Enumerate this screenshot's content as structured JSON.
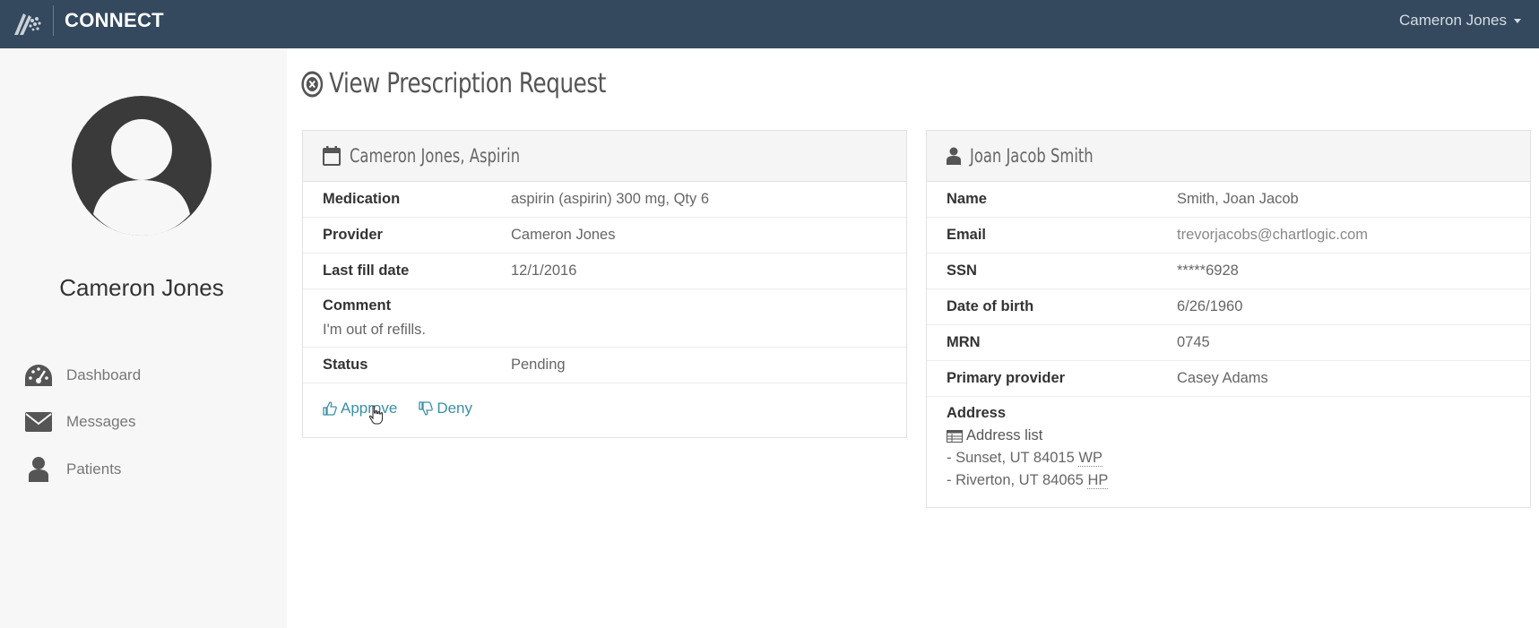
{
  "app": {
    "title": "CONNECT",
    "user_menu_label": "Cameron Jones"
  },
  "sidebar": {
    "profile_name": "Cameron Jones",
    "items": [
      {
        "label": "Dashboard",
        "icon": "dashboard-icon"
      },
      {
        "label": "Messages",
        "icon": "envelope-icon"
      },
      {
        "label": "Patients",
        "icon": "user-icon"
      }
    ]
  },
  "page": {
    "title": "View Prescription Request"
  },
  "request_panel": {
    "title": "Cameron Jones, Aspirin",
    "rows": [
      {
        "label": "Medication",
        "value": "aspirin (aspirin) 300 mg, Qty 6"
      },
      {
        "label": "Provider",
        "value": "Cameron Jones"
      },
      {
        "label": "Last fill date",
        "value": "12/1/2016"
      }
    ],
    "comment_label": "Comment",
    "comment_value": "I'm out of refills.",
    "status_label": "Status",
    "status_value": "Pending",
    "approve_label": "Approve",
    "deny_label": "Deny"
  },
  "patient_panel": {
    "title": "Joan Jacob Smith",
    "name_label": "Name",
    "name_value": "Smith, Joan Jacob",
    "rows": [
      {
        "label": "Email",
        "value": "trevorjacobs@chartlogic.com"
      },
      {
        "label": "SSN",
        "value": "*****6928"
      },
      {
        "label": "Date of birth",
        "value": "6/26/1960"
      },
      {
        "label": "MRN",
        "value": "0745"
      },
      {
        "label": "Primary provider",
        "value": "Casey Adams"
      }
    ],
    "address_label": "Address",
    "address_list_label": "Address list",
    "addresses": [
      {
        "text": "- Sunset, UT 84015",
        "type": "WP"
      },
      {
        "text": "- Riverton, UT 84065",
        "type": "HP"
      }
    ]
  },
  "colors": {
    "topbar": "#34495e",
    "link": "#3a8fa6",
    "sidebar_bg": "#f7f7f7"
  }
}
